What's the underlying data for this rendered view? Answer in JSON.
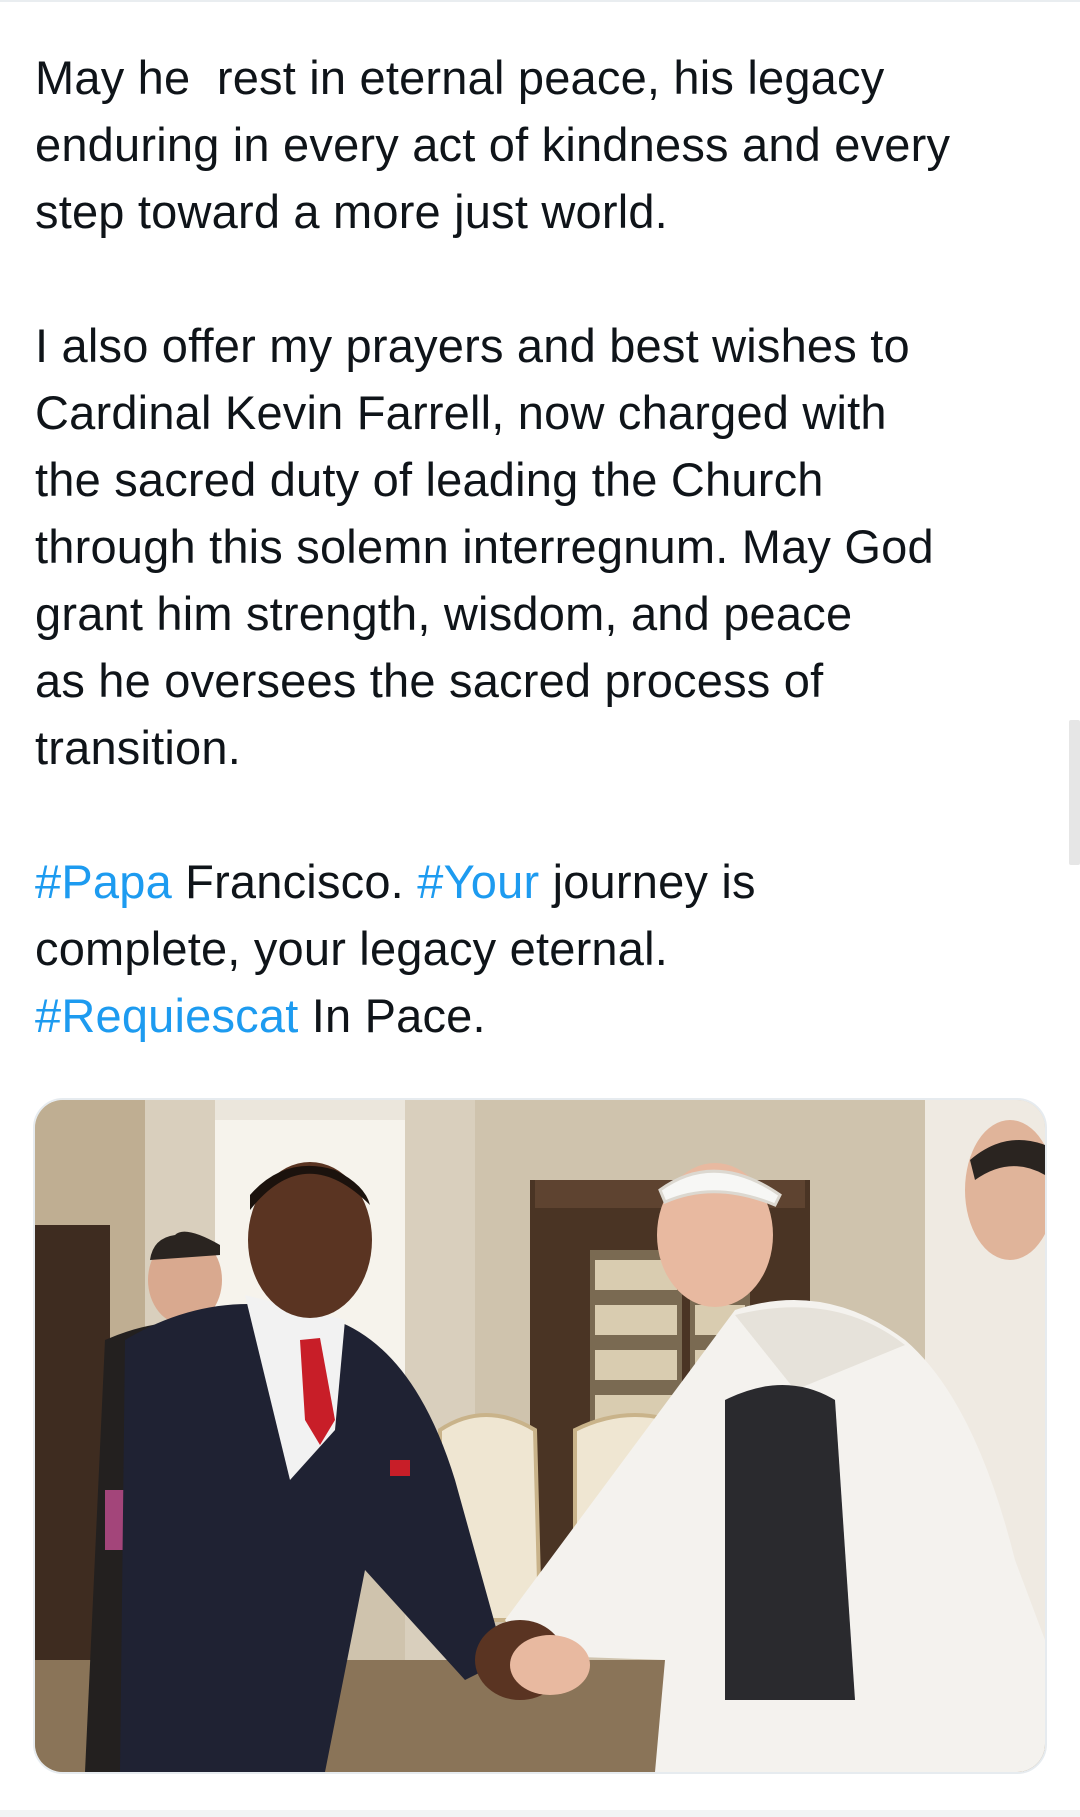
{
  "tweet": {
    "paragraphs": [
      {
        "lines": [
          [
            {
              "t": "May he  rest in eternal peace, his legacy",
              "tag": false
            }
          ],
          [
            {
              "t": "enduring in every act of kindness and every",
              "tag": false
            }
          ],
          [
            {
              "t": "step toward a more just world.",
              "tag": false
            }
          ]
        ]
      },
      {
        "lines": [
          [
            {
              "t": "I also offer my prayers and best wishes to",
              "tag": false
            }
          ],
          [
            {
              "t": "Cardinal Kevin Farrell, now charged with",
              "tag": false
            }
          ],
          [
            {
              "t": "the sacred duty of leading the Church",
              "tag": false
            }
          ],
          [
            {
              "t": "through this solemn interregnum. May God",
              "tag": false
            }
          ],
          [
            {
              "t": "grant him strength, wisdom, and peace",
              "tag": false
            }
          ],
          [
            {
              "t": "as he oversees the sacred process of",
              "tag": false
            }
          ],
          [
            {
              "t": "transition.",
              "tag": false
            }
          ]
        ]
      },
      {
        "lines": [
          [
            {
              "t": "#Papa",
              "tag": true
            },
            {
              "t": " Francisco. ",
              "tag": false
            },
            {
              "t": "#Your",
              "tag": true
            },
            {
              "t": " journey is",
              "tag": false
            }
          ],
          [
            {
              "t": "complete, your legacy eternal.",
              "tag": false
            }
          ],
          [
            {
              "t": "#Requiescat",
              "tag": true
            },
            {
              "t": " In Pace.",
              "tag": false
            }
          ]
        ]
      }
    ]
  },
  "media": {
    "description": "",
    "colors": {
      "wall": "#d8cdb8",
      "bookcase": "#4a3424",
      "suit": "#1f2233",
      "tie": "#c81e28",
      "cassock": "#f4f2ee",
      "skin_dark": "#5a3422",
      "skin_light": "#e8b9a0"
    }
  },
  "colors": {
    "text": "#0f1419",
    "hashtag": "#1d9bf0",
    "border": "#e6ebef"
  }
}
